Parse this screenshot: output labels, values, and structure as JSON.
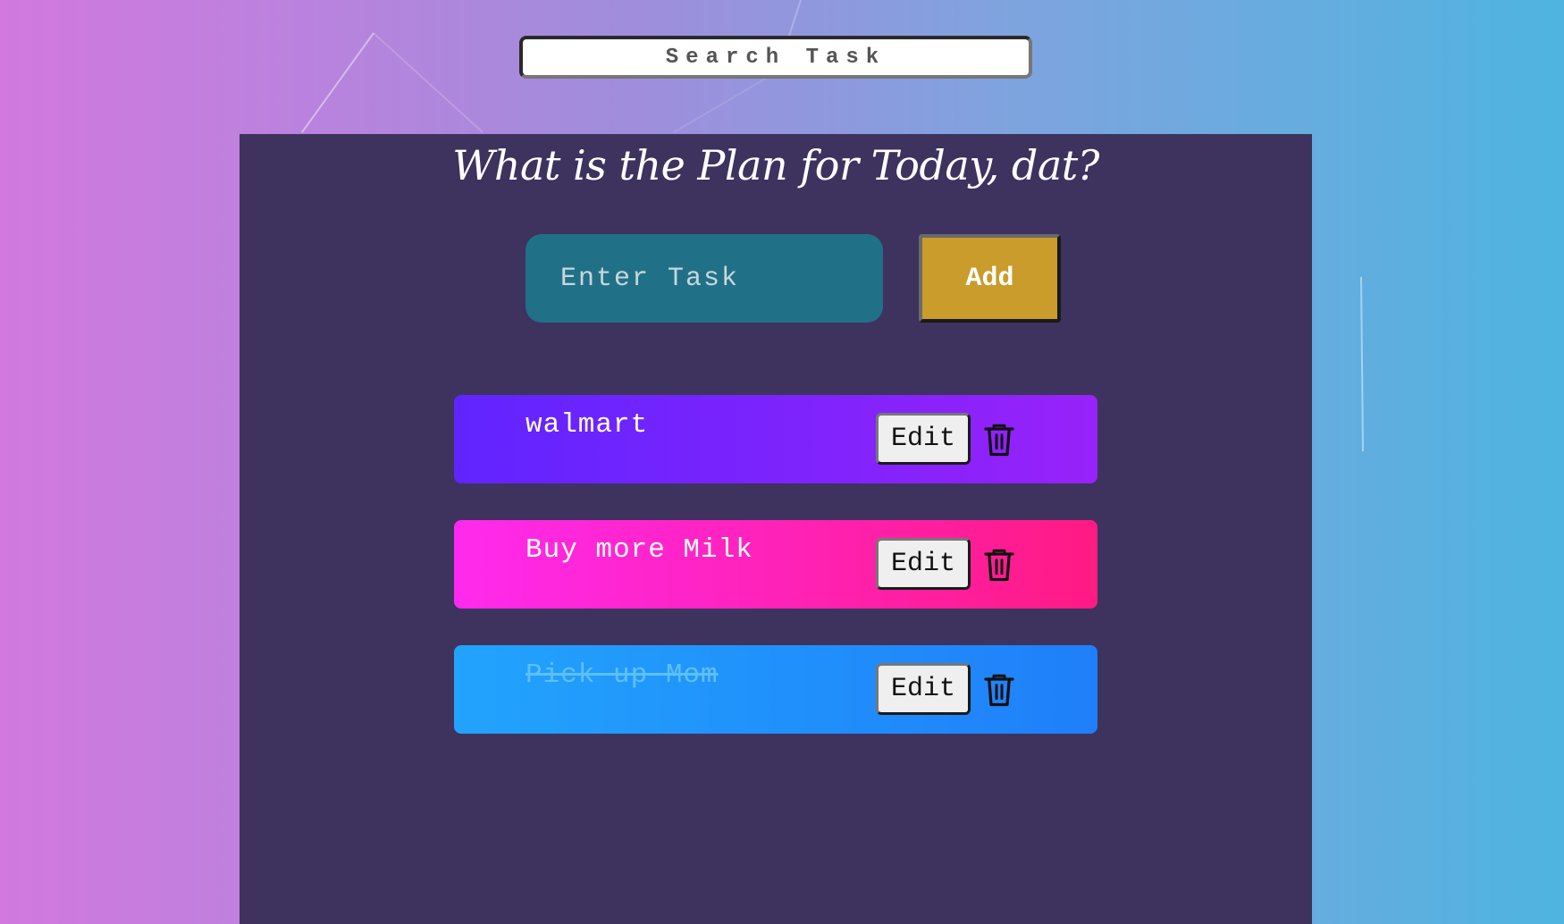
{
  "search": {
    "placeholder": "Search Task",
    "value": ""
  },
  "header": {
    "title": "What is the Plan for Today, dat?"
  },
  "new_task": {
    "placeholder": "Enter Task",
    "value": "",
    "add_label": "Add"
  },
  "tasks": [
    {
      "text": "walmart",
      "completed": false,
      "edit_label": "Edit",
      "delete_icon": "trash-icon",
      "gradient": [
        "#6024ff",
        "#9822fa"
      ]
    },
    {
      "text": "Buy more Milk",
      "completed": false,
      "edit_label": "Edit",
      "delete_icon": "trash-icon",
      "gradient": [
        "#ff2aee",
        "#ff1a83"
      ]
    },
    {
      "text": "Pick up Mom",
      "completed": true,
      "edit_label": "Edit",
      "delete_icon": "trash-icon",
      "gradient": [
        "#22a3fd",
        "#1f7ffa"
      ]
    }
  ],
  "colors": {
    "panel": "#3e325e",
    "input_bg": "#207188",
    "add_button": "#c99c2b",
    "background_left": "#d278df",
    "background_right": "#4fb4e0"
  }
}
